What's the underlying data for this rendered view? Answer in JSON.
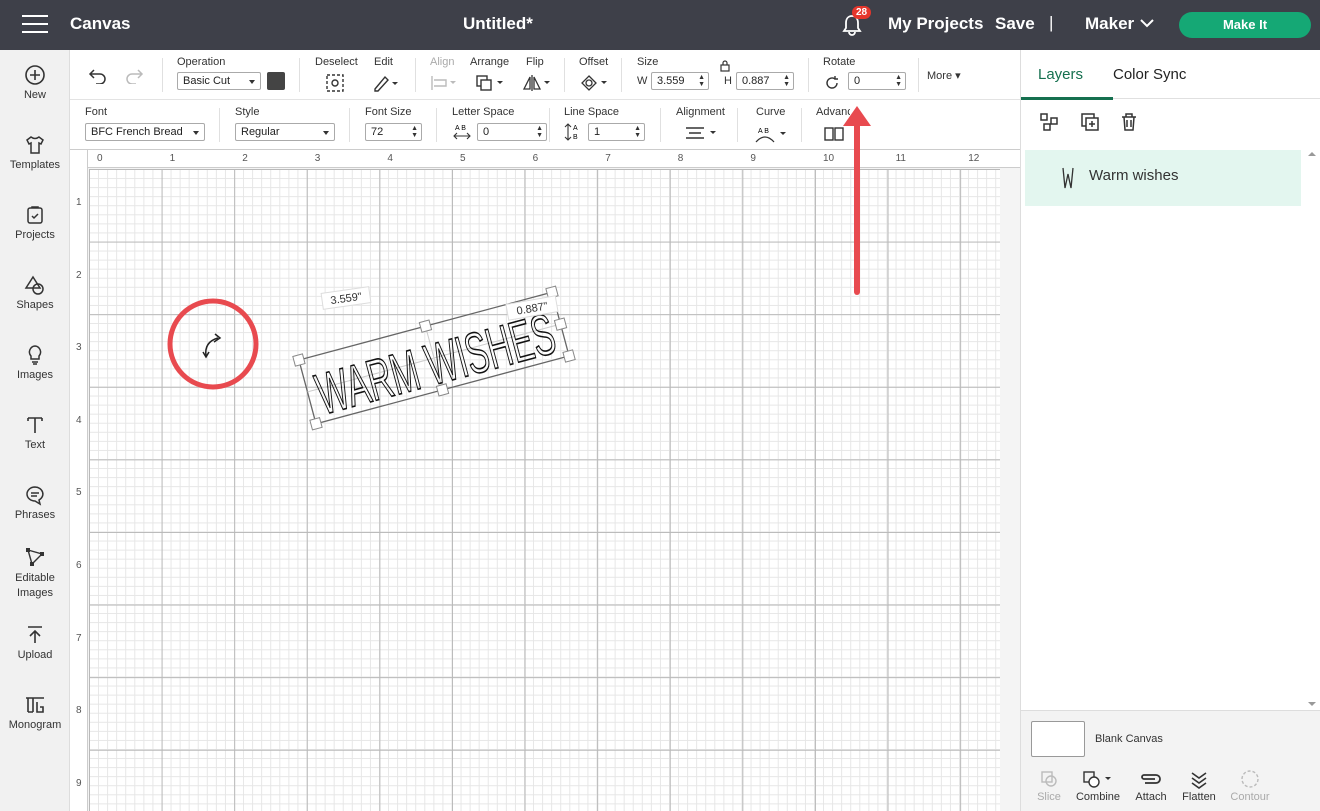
{
  "header": {
    "app_title": "Canvas",
    "document_title": "Untitled*",
    "notifications_count": "28",
    "my_projects": "My Projects",
    "save": "Save",
    "separator": "|",
    "machine": "Maker",
    "make_it": "Make It"
  },
  "sidebar": {
    "items": [
      {
        "label": "New",
        "icon": "plus-circle-icon"
      },
      {
        "label": "Templates",
        "icon": "shirt-icon"
      },
      {
        "label": "Projects",
        "icon": "projects-icon"
      },
      {
        "label": "Shapes",
        "icon": "shapes-icon"
      },
      {
        "label": "Images",
        "icon": "lightbulb-icon"
      },
      {
        "label": "Text",
        "icon": "text-icon"
      },
      {
        "label": "Phrases",
        "icon": "speech-bubble-icon"
      },
      {
        "label": "Editable Images",
        "icon": "editable-images-icon"
      },
      {
        "label": "Upload",
        "icon": "upload-icon"
      },
      {
        "label": "Monogram",
        "icon": "monogram-icon"
      }
    ]
  },
  "toolbar": {
    "operation_label": "Operation",
    "operation_value": "Basic Cut",
    "operation_color": "#444444",
    "deselect_label": "Deselect",
    "edit_label": "Edit",
    "align_label": "Align",
    "arrange_label": "Arrange",
    "flip_label": "Flip",
    "offset_label": "Offset",
    "size_label": "Size",
    "w_label": "W",
    "w_value": "3.559",
    "h_label": "H",
    "h_value": "0.887",
    "rotate_label": "Rotate",
    "rotate_value": "0",
    "more_label": "More"
  },
  "text_toolbar": {
    "font_label": "Font",
    "font_value": "BFC French Bread",
    "style_label": "Style",
    "style_value": "Regular",
    "font_size_label": "Font Size",
    "font_size_value": "72",
    "letter_space_label": "Letter Space",
    "letter_space_value": "0",
    "line_space_label": "Line Space",
    "line_space_value": "1",
    "alignment_label": "Alignment",
    "curve_label": "Curve",
    "advanced_label": "Advanced"
  },
  "canvas": {
    "ruler_top": [
      "0",
      "1",
      "2",
      "3",
      "4",
      "5",
      "6",
      "7",
      "8",
      "9",
      "10",
      "11",
      "12"
    ],
    "ruler_left": [
      "1",
      "2",
      "3",
      "4",
      "5",
      "6",
      "7",
      "8",
      "9"
    ],
    "object_text": "WARM WISHES",
    "width_dimension": "3.559\"",
    "height_dimension": "0.887\"",
    "rotation_degrees": -15,
    "highlight_color": "#e84a4f"
  },
  "right_panel": {
    "tabs": [
      "Layers",
      "Color Sync"
    ],
    "active_tab": "Layers",
    "layers": [
      {
        "name": "Warm wishes",
        "icon": "text-layer-icon"
      }
    ],
    "blank_canvas": "Blank Canvas",
    "actions": [
      {
        "label": "Slice",
        "enabled": false
      },
      {
        "label": "Combine",
        "enabled": true
      },
      {
        "label": "Attach",
        "enabled": true
      },
      {
        "label": "Flatten",
        "enabled": true
      },
      {
        "label": "Contour",
        "enabled": false
      }
    ]
  }
}
